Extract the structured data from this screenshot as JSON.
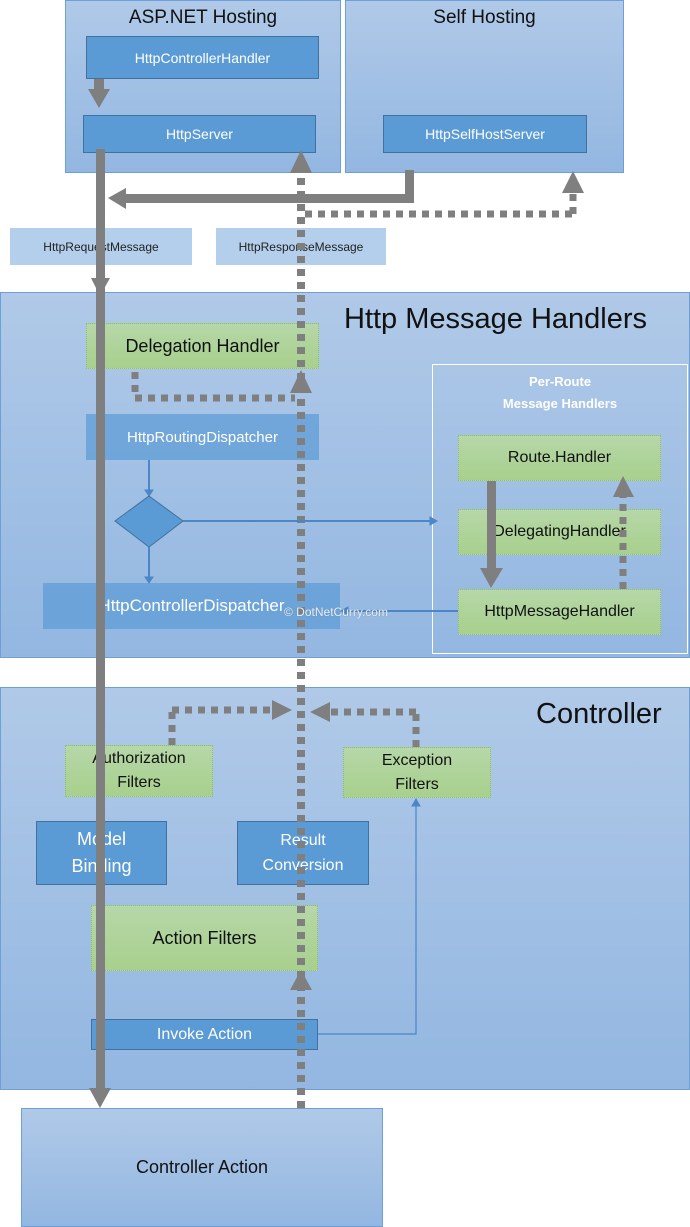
{
  "hosting": {
    "aspnet": {
      "title": "ASP.NET Hosting",
      "controller_handler": "HttpControllerHandler",
      "server": "HttpServer"
    },
    "self": {
      "title": "Self Hosting",
      "server": "HttpSelfHostServer"
    }
  },
  "messages": {
    "request": "HttpRequestMessage",
    "response": "HttpResponseMessage"
  },
  "message_handlers": {
    "title": "Http Message Handlers",
    "delegation_handler": "Delegation Handler",
    "routing_dispatcher": "HttpRoutingDispatcher",
    "controller_dispatcher": "HttpControllerDispatcher",
    "per_route": {
      "title_line1": "Per-Route",
      "title_line2": "Message Handlers",
      "route_handler": "Route.Handler",
      "delegating_handler": "DelegatingHandler",
      "message_handler": "HttpMessageHandler"
    }
  },
  "controller": {
    "title": "Controller",
    "authorization_filters_line1": "Authorization",
    "authorization_filters_line2": "Filters",
    "exception_filters_line1": "Exception",
    "exception_filters_line2": "Filters",
    "model_binding_line1": "Model",
    "model_binding_line2": "Binding",
    "result_conversion_line1": "Result",
    "result_conversion_line2": "Conversion",
    "action_filters": "Action Filters",
    "invoke_action": "Invoke Action"
  },
  "controller_action": "Controller Action",
  "watermark": "© DotNetCurry.com",
  "colors": {
    "region_blue": "#a4c2e6",
    "box_blue": "#5b9bd5",
    "green": "#a9d18e",
    "arrow_gray": "#7f7f7f"
  }
}
